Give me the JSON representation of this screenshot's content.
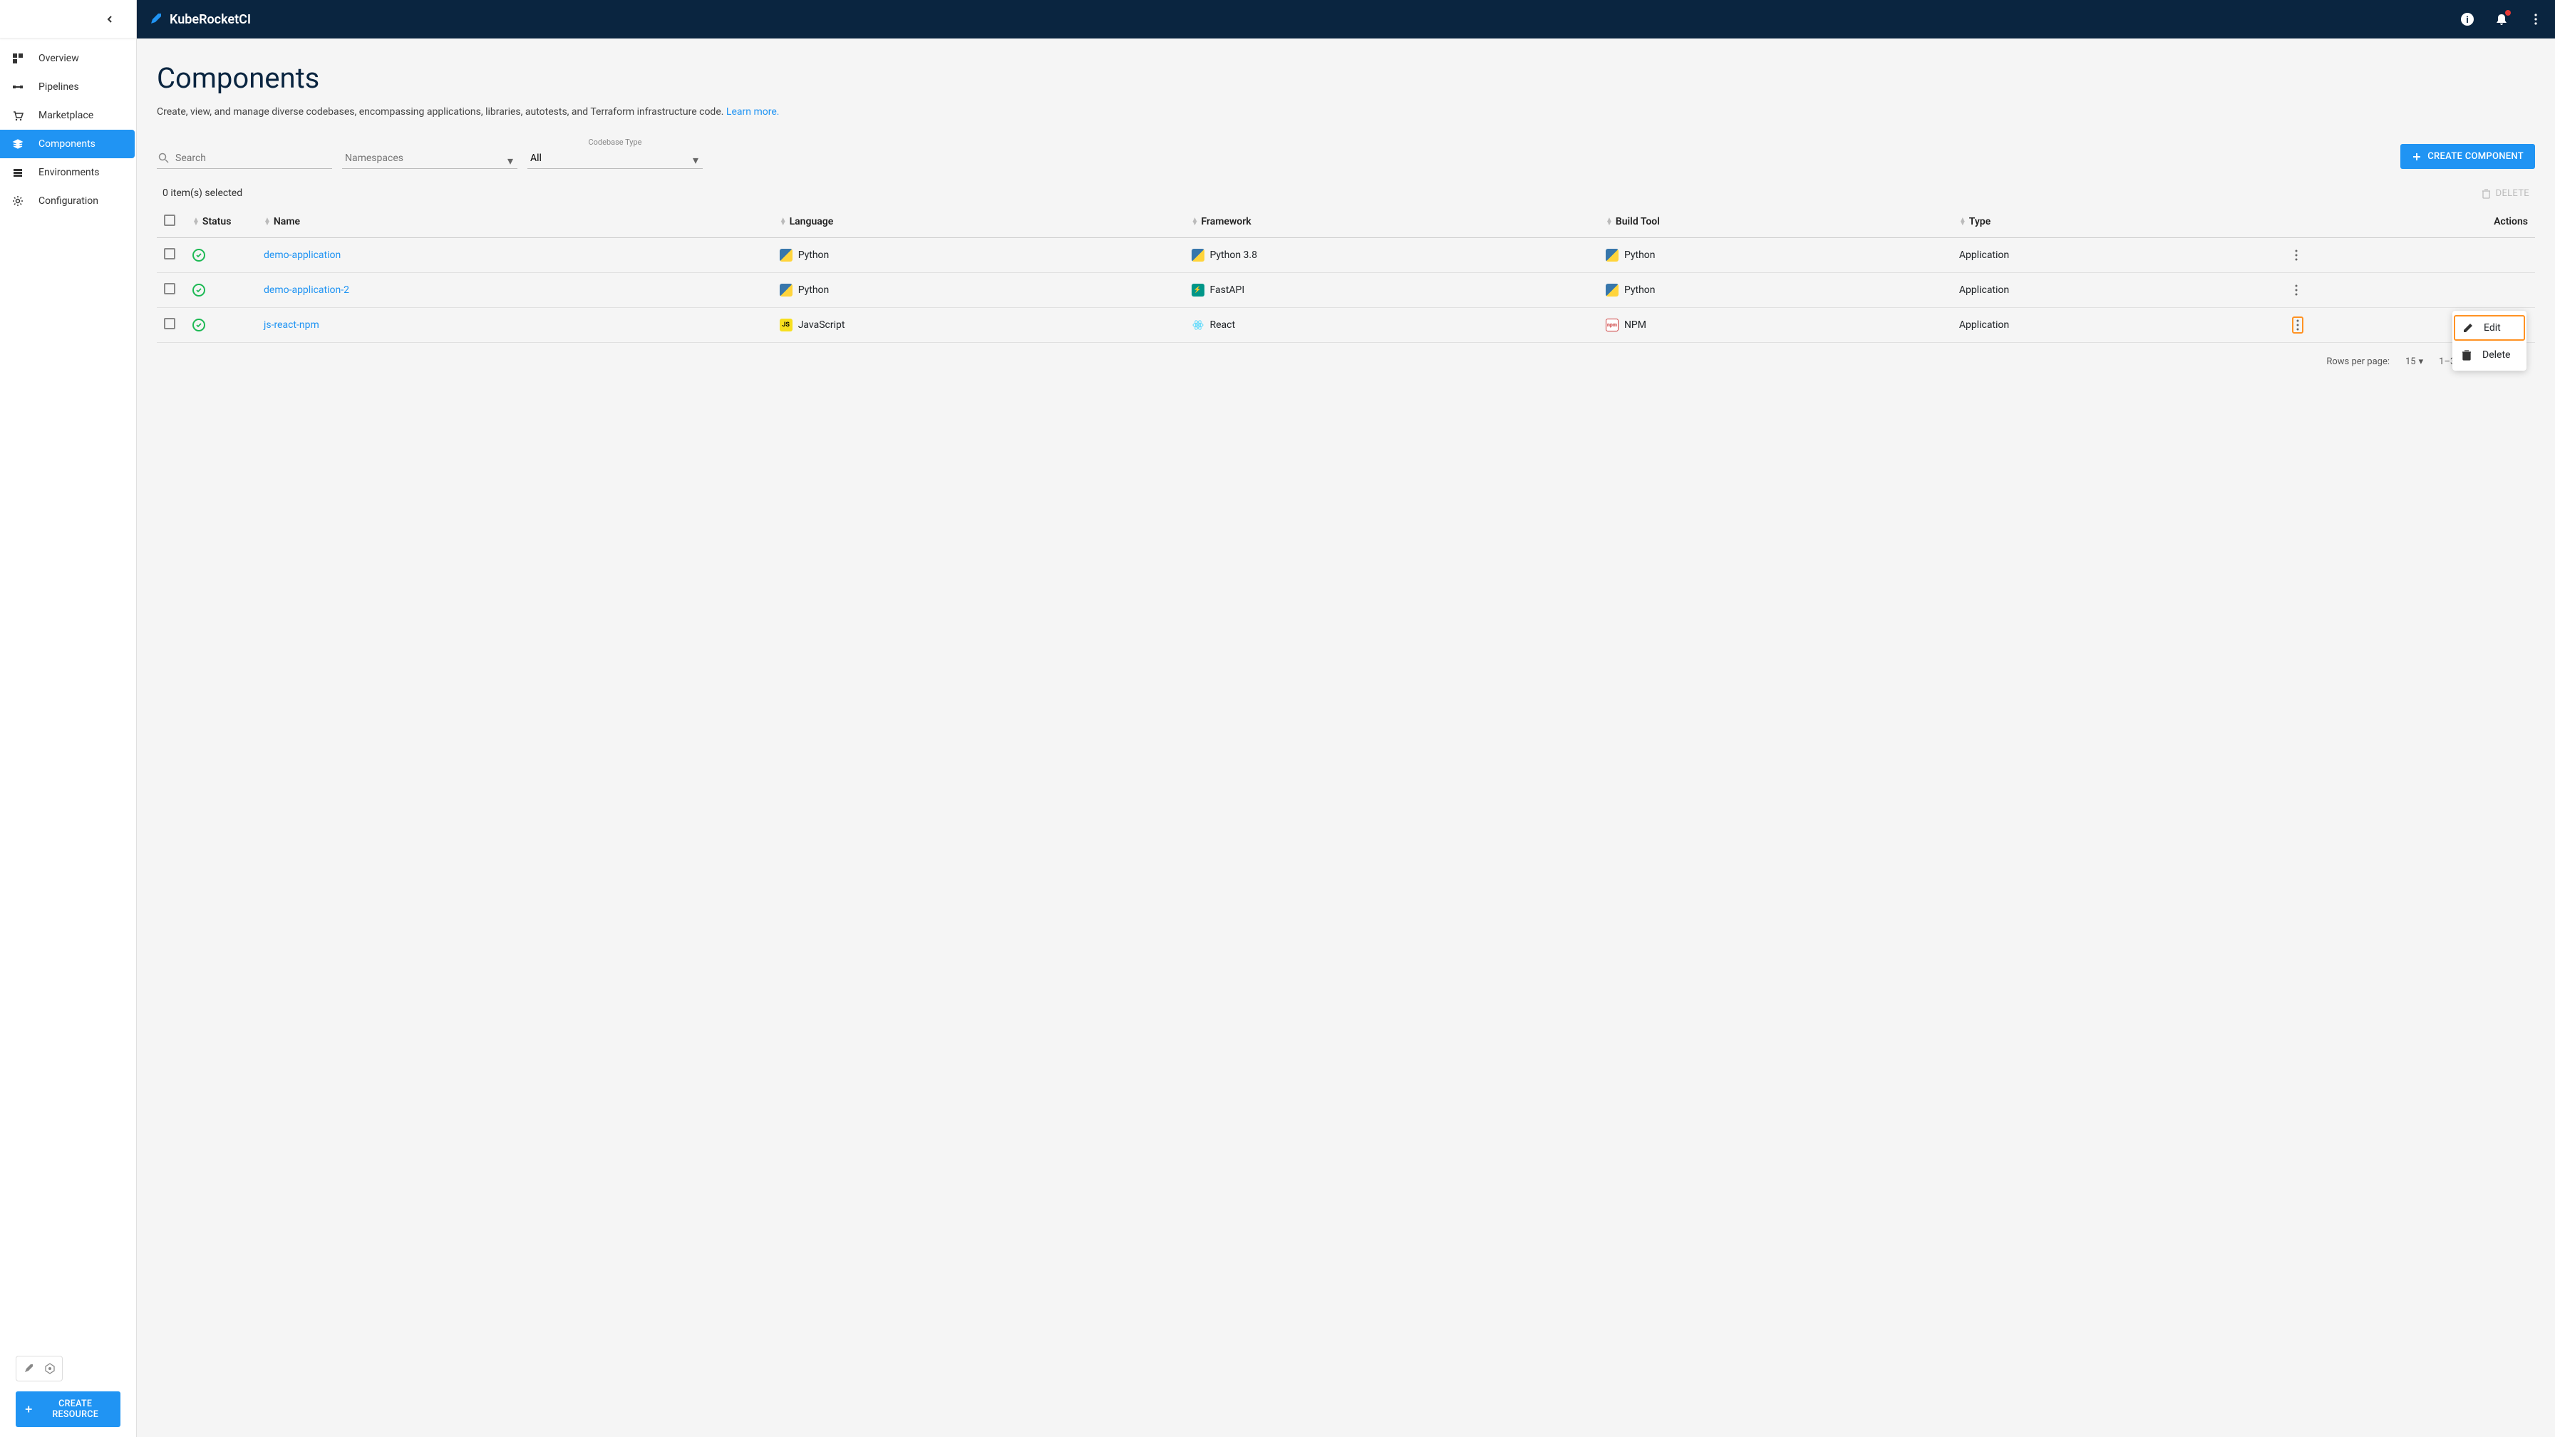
{
  "brand": "KubeRocketCI",
  "sidebar": {
    "items": [
      {
        "label": "Overview",
        "icon": "dashboard"
      },
      {
        "label": "Pipelines",
        "icon": "pipeline"
      },
      {
        "label": "Marketplace",
        "icon": "cart"
      },
      {
        "label": "Components",
        "icon": "layers",
        "active": true
      },
      {
        "label": "Environments",
        "icon": "envs"
      },
      {
        "label": "Configuration",
        "icon": "gear"
      }
    ],
    "create_resource": "CREATE RESOURCE"
  },
  "page": {
    "title": "Components",
    "subtitle": "Create, view, and manage diverse codebases, encompassing applications, libraries, autotests, and Terraform infrastructure code.",
    "learn_more": "Learn more."
  },
  "filters": {
    "search_placeholder": "Search",
    "namespaces_placeholder": "Namespaces",
    "codebase_type_label": "Codebase Type",
    "codebase_type_value": "All",
    "create_component": "CREATE COMPONENT"
  },
  "toolbar": {
    "selected": "0 item(s) selected",
    "delete": "DELETE"
  },
  "table": {
    "headers": {
      "status": "Status",
      "name": "Name",
      "language": "Language",
      "framework": "Framework",
      "build_tool": "Build Tool",
      "type": "Type",
      "actions": "Actions"
    },
    "rows": [
      {
        "name": "demo-application",
        "language": "Python",
        "framework": "Python 3.8",
        "build_tool": "Python",
        "type": "Application",
        "lang_icon": "python",
        "fw_icon": "python",
        "bt_icon": "python"
      },
      {
        "name": "demo-application-2",
        "language": "Python",
        "framework": "FastAPI",
        "build_tool": "Python",
        "type": "Application",
        "lang_icon": "python",
        "fw_icon": "fastapi",
        "bt_icon": "python"
      },
      {
        "name": "js-react-npm",
        "language": "JavaScript",
        "framework": "React",
        "build_tool": "NPM",
        "type": "Application",
        "lang_icon": "js",
        "fw_icon": "react",
        "bt_icon": "npm"
      }
    ]
  },
  "context_menu": {
    "edit": "Edit",
    "delete": "Delete"
  },
  "pagination": {
    "rows_label": "Rows per page:",
    "rows_value": "15",
    "range": "1–3 of 3"
  }
}
